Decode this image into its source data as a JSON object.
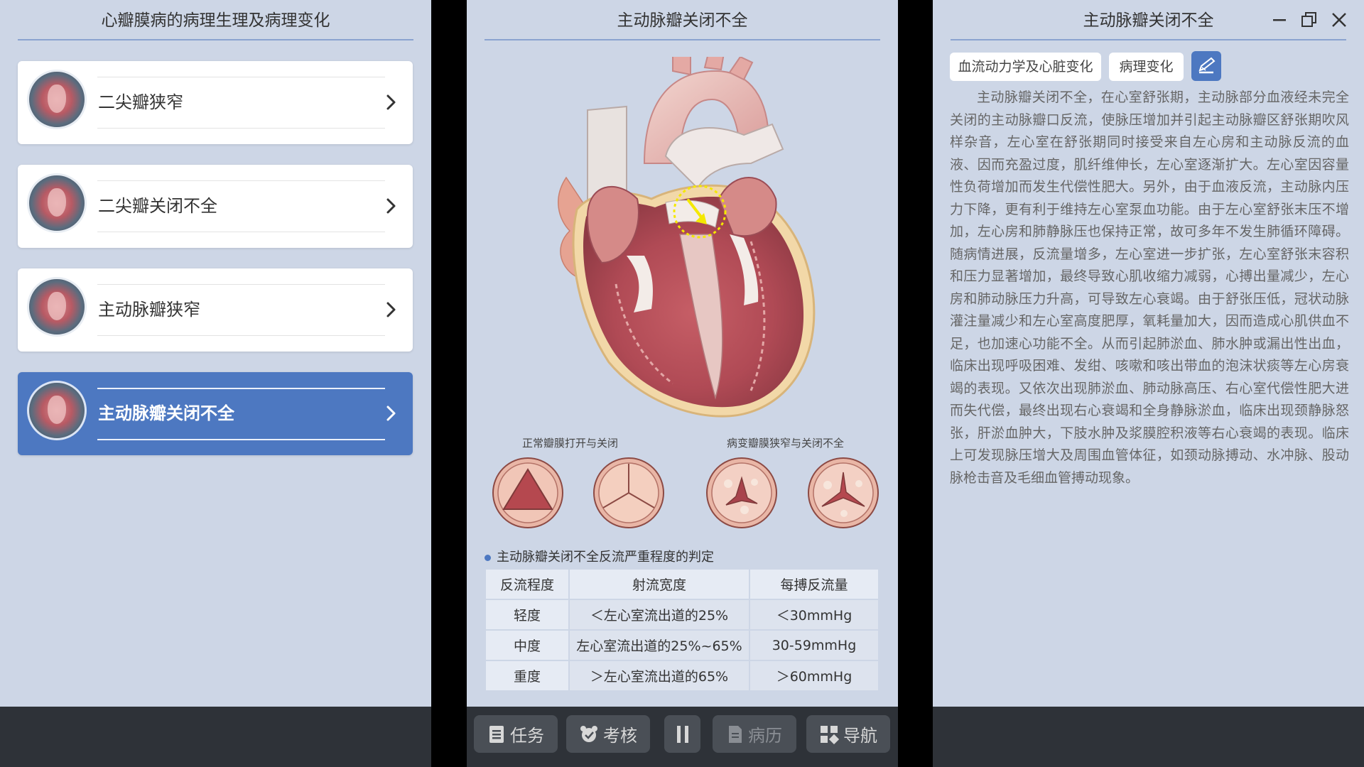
{
  "left": {
    "title": "心瓣膜病的病理生理及病理变化",
    "items": [
      {
        "label": "二尖瓣狭窄"
      },
      {
        "label": "二尖瓣关闭不全"
      },
      {
        "label": "主动脉瓣狭窄"
      },
      {
        "label": "主动脉瓣关闭不全"
      }
    ]
  },
  "center": {
    "title": "主动脉瓣关闭不全",
    "caption_normal": "正常瓣膜打开与关闭",
    "caption_diseased": "病变瓣膜狭窄与关闭不全",
    "bullet": "主动脉瓣关闭不全反流严重程度的判定",
    "table": {
      "headers": [
        "反流程度",
        "射流宽度",
        "每搏反流量"
      ],
      "rows": [
        [
          "轻度",
          "＜左心室流出道的25%",
          "＜30mmHg"
        ],
        [
          "中度",
          "左心室流出道的25%~65%",
          "30-59mmHg"
        ],
        [
          "重度",
          "＞左心室流出道的65%",
          "＞60mmHg"
        ]
      ]
    },
    "controls": {
      "task": "任务",
      "exam": "考核",
      "record": "病历",
      "nav": "导航"
    }
  },
  "right": {
    "title": "主动脉瓣关闭不全",
    "tab1": "血流动力学及心脏变化",
    "tab2": "病理变化",
    "text": "主动脉瓣关闭不全，在心室舒张期，主动脉部分血液经未完全关闭的主动脉瓣口反流，使脉压增加并引起主动脉瓣区舒张期吹风样杂音，左心室在舒张期同时接受来自左心房和主动脉反流的血液、因而充盈过度，肌纤维伸长，左心室逐渐扩大。左心室因容量性负荷增加而发生代偿性肥大。另外，由于血液反流，主动脉内压力下降，更有利于维持左心室泵血功能。由于左心室舒张末压不增加，左心房和肺静脉压也保持正常，故可多年不发生肺循环障碍。随病情进展，反流量增多，左心室进一步扩张，左心室舒张末容积和压力显著增加，最终导致心肌收缩力减弱，心搏出量减少，左心房和肺动脉压力升高，可导致左心衰竭。由于舒张压低，冠状动脉灌注量减少和左心室高度肥厚，氧耗量加大，因而造成心肌供血不足，也加速心功能不全。从而引起肺淤血、肺水肿或漏出性出血，临床出现呼吸困难、发绀、咳嗽和咳出带血的泡沫状痰等左心房衰竭的表现。又依次出现肺淤血、肺动脉高压、右心室代偿性肥大进而失代偿，最终出现右心衰竭和全身静脉淤血，临床出现颈静脉怒张，肝淤血肿大，下肢水肿及浆膜腔积液等右心衰竭的表现。临床上可发现脉压增大及周围血管体征，如颈动脉搏动、水冲脉、股动脉枪击音及毛细血管搏动现象。"
  },
  "colors": {
    "panel_bg": "#cdd6e6",
    "accent": "#4d78c1",
    "bar_bg": "#2e3238",
    "button_bg": "#4a4f56"
  }
}
